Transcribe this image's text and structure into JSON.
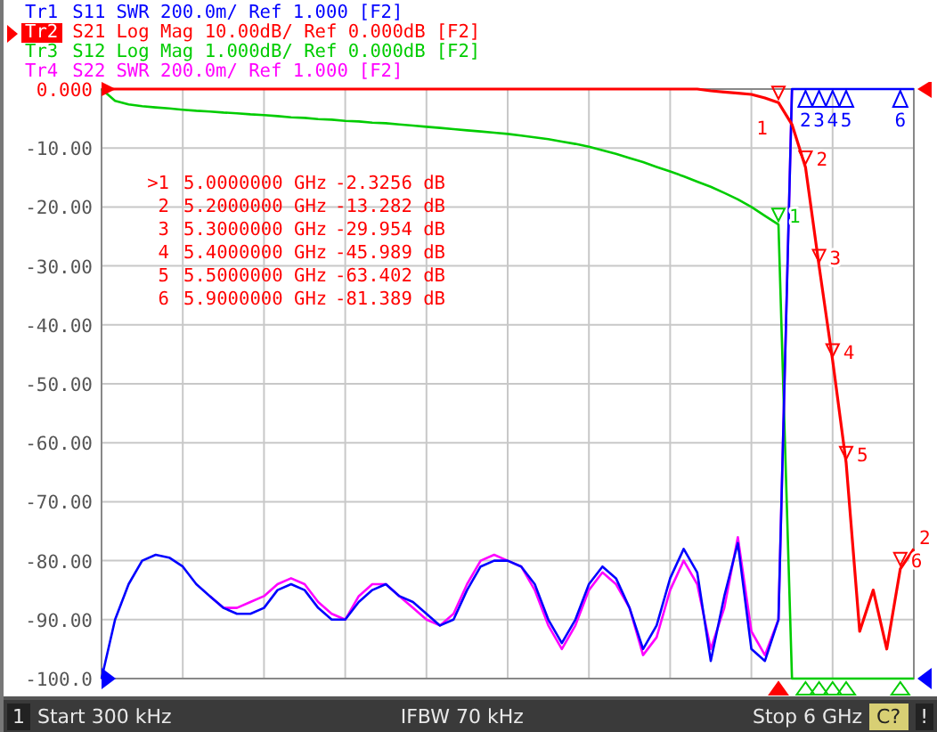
{
  "traces": [
    {
      "name": "Tr1",
      "setting": "SWR 200.0m/ Ref 1.000",
      "tag": "[F2]",
      "color": "#0000ff",
      "selected": false
    },
    {
      "name": "Tr2",
      "setting": "Log Mag 10.00dB/ Ref 0.000dB",
      "tag": "[F2]",
      "color": "#ff0000",
      "selected": true
    },
    {
      "name": "Tr3",
      "setting": "Log Mag 1.000dB/ Ref 0.000dB",
      "tag": "[F2]",
      "color": "#00cc00",
      "selected": false
    },
    {
      "name": "Tr4",
      "setting": "SWR 200.0m/ Ref 1.000",
      "tag": "[F2]",
      "color": "#ff00ff",
      "selected": false
    }
  ],
  "marker_table": [
    {
      "number": ">1",
      "frequency": "5.0000000 GHz",
      "value": "-2.3256 dB"
    },
    {
      "number": "2",
      "frequency": "5.2000000 GHz",
      "value": "-13.282 dB"
    },
    {
      "number": "3",
      "frequency": "5.3000000 GHz",
      "value": "-29.954 dB"
    },
    {
      "number": "4",
      "frequency": "5.4000000 GHz",
      "value": "-45.989 dB"
    },
    {
      "number": "5",
      "frequency": "5.5000000 GHz",
      "value": "-63.402 dB"
    },
    {
      "number": "6",
      "frequency": "5.9000000 GHz",
      "value": "-81.389 dB"
    }
  ],
  "chart_data": {
    "type": "line",
    "categories": [
      null,
      null,
      null,
      null,
      null,
      null,
      null,
      null,
      null,
      null,
      null,
      null,
      null,
      null,
      null,
      null,
      null,
      null,
      null,
      null,
      null,
      null,
      null,
      null,
      null,
      null,
      null,
      null,
      null,
      null,
      null,
      null,
      null,
      null,
      null,
      null,
      null,
      null,
      null,
      null,
      null,
      null,
      null,
      null,
      null,
      null,
      null,
      null,
      null,
      null,
      null,
      null,
      null,
      null,
      null,
      null,
      null,
      null,
      null,
      null,
      null
    ],
    "ylim": [
      -100,
      0
    ],
    "yticks": [
      {
        "value": 0,
        "label": "0.000"
      },
      {
        "value": -10,
        "label": "-10.00"
      },
      {
        "value": -20,
        "label": "-20.00"
      },
      {
        "value": -30,
        "label": "-30.00"
      },
      {
        "value": -40,
        "label": "-40.00"
      },
      {
        "value": -50,
        "label": "-50.00"
      },
      {
        "value": -60,
        "label": "-60.00"
      },
      {
        "value": -70,
        "label": "-70.00"
      },
      {
        "value": -80,
        "label": "-80.00"
      },
      {
        "value": -90,
        "label": "-90.00"
      },
      {
        "value": -100,
        "label": "-100.0"
      }
    ],
    "series": [
      {
        "name": "S11",
        "color": "#0000ff",
        "values": [
          -100,
          -90,
          -84,
          -80,
          -79,
          -79.5,
          -81,
          -84,
          -86,
          -88,
          -89,
          -89,
          -88,
          -85,
          -84,
          -85,
          -88,
          -90,
          -90,
          -87,
          -85,
          -84,
          -86,
          -87,
          -89,
          -91,
          -90,
          -85,
          -81,
          -80,
          -80,
          -81,
          -84,
          -90,
          -94,
          -90,
          -84,
          -81,
          -83,
          -88,
          -95,
          -91,
          -83,
          -78,
          -82,
          -97,
          -86,
          -77,
          -95,
          -97,
          -90,
          0,
          0,
          0,
          0,
          0,
          0,
          0,
          0,
          0,
          0
        ]
      },
      {
        "name": "S21",
        "color": "#ff0000",
        "values": [
          0,
          0,
          0,
          0,
          0,
          0,
          0,
          0,
          0,
          0,
          0,
          0,
          0,
          0,
          0,
          0,
          0,
          0,
          0,
          0,
          0,
          0,
          0,
          0,
          0,
          0,
          0,
          0,
          0,
          0,
          0,
          0,
          0,
          0,
          0,
          0,
          0,
          0,
          0,
          0,
          0,
          0,
          0,
          0,
          0,
          -0.3,
          -0.5,
          -0.7,
          -0.9,
          -1.5,
          -2.3,
          -6,
          -13.3,
          -30,
          -46,
          -63.4,
          -92,
          -85,
          -95,
          -81.4,
          -78
        ]
      },
      {
        "name": "S12",
        "color": "#00cc00",
        "values": [
          0,
          -2,
          -2.6,
          -2.9,
          -3.1,
          -3.3,
          -3.5,
          -3.7,
          -3.8,
          -4,
          -4.1,
          -4.3,
          -4.4,
          -4.6,
          -4.8,
          -4.9,
          -5.1,
          -5.2,
          -5.4,
          -5.5,
          -5.7,
          -5.8,
          -6,
          -6.2,
          -6.4,
          -6.6,
          -6.8,
          -7,
          -7.2,
          -7.4,
          -7.6,
          -7.9,
          -8.2,
          -8.5,
          -8.9,
          -9.3,
          -9.8,
          -10.4,
          -11,
          -11.7,
          -12.4,
          -13.2,
          -14,
          -14.8,
          -15.7,
          -16.6,
          -17.6,
          -18.7,
          -20,
          -21.5,
          -23,
          -100,
          -100,
          -100,
          -100,
          -100,
          -100,
          -100,
          -100,
          -100,
          -100
        ]
      },
      {
        "name": "S22",
        "color": "#ff00ff",
        "values": [
          null,
          null,
          null,
          null,
          null,
          null,
          null,
          null,
          -86,
          -88,
          -88,
          -87,
          -86,
          -84,
          -83,
          -84,
          -87,
          -89,
          -90,
          -86,
          -84,
          -84,
          -86,
          -88,
          -90,
          -91,
          -89,
          -84,
          -80,
          -79,
          -80,
          -81,
          -85,
          -91,
          -95,
          -91,
          -85,
          -82,
          -84,
          -88,
          -96,
          -93,
          -85,
          -80,
          -84,
          -95,
          -88,
          -76,
          -92,
          -96,
          -90,
          0,
          null,
          null,
          null,
          null,
          null,
          null,
          null,
          null,
          null
        ]
      }
    ],
    "grid": true
  },
  "chart_markers": [
    {
      "label": "1",
      "color": "#ff0000"
    },
    {
      "label": "2",
      "color": "#ff0000"
    },
    {
      "label": "3",
      "color": "#ff0000"
    },
    {
      "label": "4",
      "color": "#ff0000"
    },
    {
      "label": "5",
      "color": "#ff0000"
    },
    {
      "label": "6",
      "color": "#ff0000"
    },
    {
      "label": "1",
      "color": "#00cc00"
    },
    {
      "label": "2",
      "color": "#0000ff"
    },
    {
      "label": "3",
      "color": "#0000ff"
    },
    {
      "label": "4",
      "color": "#0000ff"
    },
    {
      "label": "5",
      "color": "#0000ff"
    },
    {
      "label": "6",
      "color": "#0000ff"
    },
    {
      "label": "2",
      "color": "#ff0000"
    }
  ],
  "status_bar": {
    "channel": "1",
    "start": "Start 300 kHz",
    "ifbw": "IFBW 70 kHz",
    "stop": "Stop 6 GHz",
    "calibration": "C?",
    "alert": "!"
  }
}
